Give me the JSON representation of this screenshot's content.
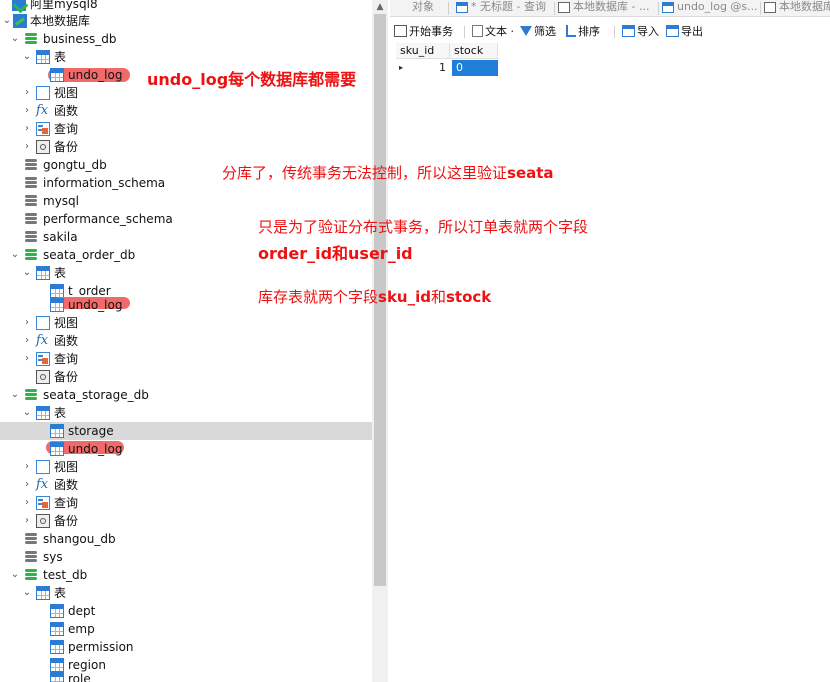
{
  "tree": {
    "connection": "阿里mysql8",
    "local": "本地数据库",
    "business_db": {
      "name": "business_db",
      "tables_label": "表",
      "undo_log": "undo_log",
      "view": "视图",
      "func": "函数",
      "query": "查询",
      "backup": "备份"
    },
    "other_dbs": [
      "gongtu_db",
      "information_schema",
      "mysql",
      "performance_schema",
      "sakila"
    ],
    "seata_order_db": {
      "name": "seata_order_db",
      "tables_label": "表",
      "t_order": "t_order",
      "undo_log": "undo_log",
      "view": "视图",
      "func": "函数",
      "query": "查询",
      "backup": "备份"
    },
    "seata_storage_db": {
      "name": "seata_storage_db",
      "tables_label": "表",
      "storage": "storage",
      "undo_log": "undo_log",
      "view": "视图",
      "func": "函数",
      "query": "查询",
      "backup": "备份"
    },
    "shangou_db": "shangou_db",
    "sys": "sys",
    "test_db": {
      "name": "test_db",
      "tables_label": "表",
      "tables": [
        "dept",
        "emp",
        "permission",
        "region",
        "role"
      ]
    }
  },
  "tabs": [
    "对象",
    "* 无标题 - 查询",
    "本地数据库 - ...",
    "undo_log @s...",
    "本地数据库"
  ],
  "toolbar": {
    "begin": "开始事务",
    "text": "文本 ·",
    "filter": "筛选",
    "sort": "排序",
    "import": "导入",
    "export": "导出"
  },
  "grid": {
    "columns": [
      "sku_id",
      "stock"
    ],
    "row": {
      "sku_id": "1",
      "stock": "0"
    }
  },
  "notes": {
    "n1": "undo_log每个数据库都需要",
    "n2_a": "分库了，传统事务无法控制，所以这里验证",
    "n2_b": "seata",
    "n3": "只是为了验证分布式事务，所以订单表就两个字段",
    "n4_a": "order_id",
    "n4_b": "和",
    "n4_c": "user_id",
    "n5_a": "库存表就两个字段",
    "n5_b": "sku_id",
    "n5_c": "和",
    "n5_d": "stock"
  },
  "colors": {
    "accent_red": "#ee1111",
    "highlight": "#f06a6a",
    "db_green": "#2fb24c",
    "table_blue": "#2e7bd3",
    "selection": "#d9d9d9",
    "cell_selected": "#1f7fd8"
  }
}
